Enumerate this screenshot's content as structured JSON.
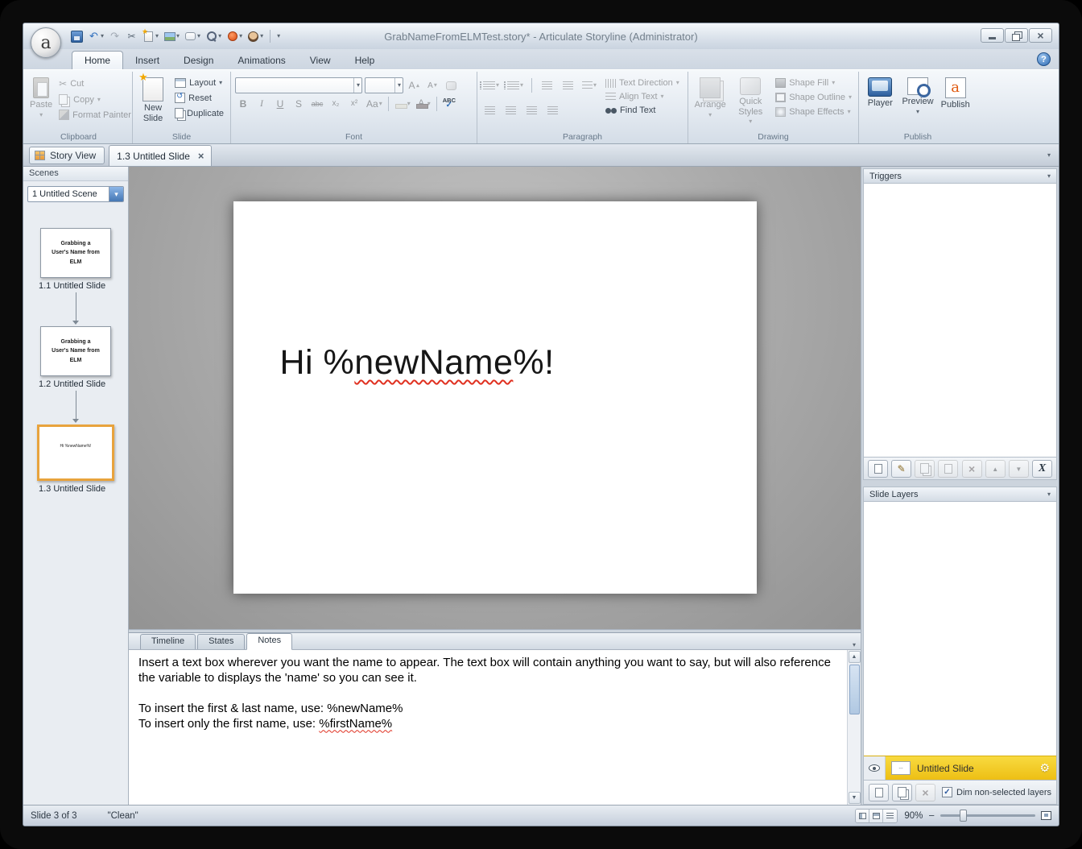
{
  "window": {
    "title": "GrabNameFromELMTest.story*  -  Articulate Storyline (Administrator)",
    "logo_letter": "a"
  },
  "colors": {
    "selection_orange": "#E8A33D",
    "layer_yellow": "#EDBF14",
    "accent_blue": "#2E5F9E"
  },
  "ribbon": {
    "tabs": [
      {
        "label": "Home"
      },
      {
        "label": "Insert"
      },
      {
        "label": "Design"
      },
      {
        "label": "Animations"
      },
      {
        "label": "View"
      },
      {
        "label": "Help"
      }
    ],
    "groups": {
      "clipboard": {
        "label": "Clipboard",
        "paste": "Paste",
        "cut": "Cut",
        "copy": "Copy",
        "format_painter": "Format Painter"
      },
      "slide": {
        "label": "Slide",
        "new_slide": "New Slide",
        "layout": "Layout",
        "reset": "Reset",
        "duplicate": "Duplicate"
      },
      "font": {
        "label": "Font",
        "bold": "B",
        "italic": "I",
        "underline": "U",
        "shadow": "S",
        "strike": "abc",
        "subscript": "x₂",
        "superscript": "x²",
        "change_case": "Aa",
        "spelling": "ABC"
      },
      "paragraph": {
        "label": "Paragraph",
        "text_direction": "Text Direction",
        "align_text": "Align Text",
        "find_text": "Find Text"
      },
      "drawing": {
        "label": "Drawing",
        "arrange": "Arrange",
        "quick_styles": "Quick Styles",
        "shape_fill": "Shape Fill",
        "shape_outline": "Shape Outline",
        "shape_effects": "Shape Effects"
      },
      "publish": {
        "label": "Publish",
        "player": "Player",
        "preview": "Preview",
        "publish": "Publish"
      }
    }
  },
  "doc_tabs": {
    "story_view": "Story View",
    "active_tab": "1.3 Untitled Slide"
  },
  "scenes": {
    "header": "Scenes",
    "selected_scene": "1 Untitled Scene",
    "slides": [
      {
        "thumb": "Grabbing a User's Name from ELM",
        "label": "1.1 Untitled Slide"
      },
      {
        "thumb": "Grabbing a User's Name from ELM",
        "label": "1.2 Untitled Slide"
      },
      {
        "thumb": "Hi %newName%!",
        "label": "1.3 Untitled Slide"
      }
    ]
  },
  "slide_canvas": {
    "text_prefix": "Hi %",
    "text_variable": "newName",
    "text_suffix": "%!"
  },
  "bottom_panel": {
    "tabs": [
      {
        "label": "Timeline"
      },
      {
        "label": "States"
      },
      {
        "label": "Notes"
      }
    ],
    "notes": {
      "paragraph1": "Insert a text box wherever you want the name to appear.  The text box will contain anything you want to say, but will also reference the variable to displays the 'name' so you can see it.",
      "first_last_prefix": "To insert the first & last name, use:  ",
      "first_last_var": "%newName%",
      "first_only_prefix": "To insert only the first name, use:  ",
      "first_only_var": "%firstName%"
    }
  },
  "triggers_panel": {
    "header": "Triggers"
  },
  "layers_panel": {
    "header": "Slide Layers",
    "base_layer_name": "Untitled Slide",
    "dim_checkbox_label": "Dim non-selected layers"
  },
  "status_bar": {
    "slide_position": "Slide 3 of 3",
    "state": "\"Clean\"",
    "zoom_level": "90%"
  }
}
